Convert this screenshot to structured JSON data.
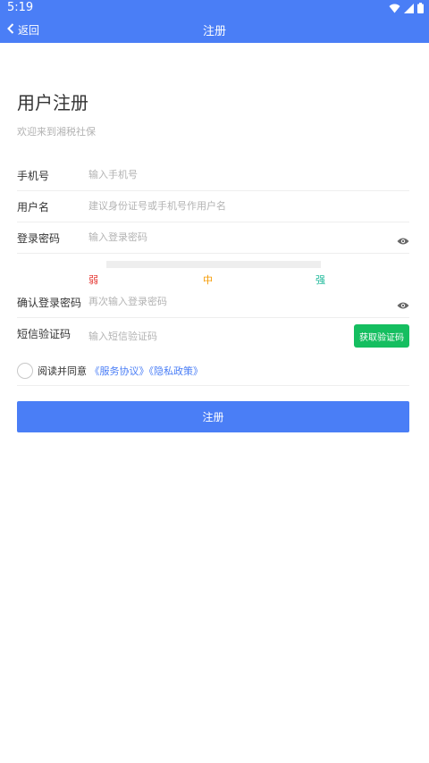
{
  "status_bar": {
    "time": "5:19"
  },
  "app_bar": {
    "back_label": "返回",
    "title": "注册"
  },
  "page": {
    "title": "用户注册",
    "subtitle": "欢迎来到湘税社保"
  },
  "fields": {
    "phone": {
      "label": "手机号",
      "placeholder": "输入手机号",
      "value": ""
    },
    "username": {
      "label": "用户名",
      "placeholder": "建议身份证号或手机号作用户名",
      "value": ""
    },
    "password": {
      "label": "登录密码",
      "placeholder": "输入登录密码",
      "value": ""
    },
    "confirm_password": {
      "label": "确认登录密码",
      "placeholder": "再次输入登录密码",
      "value": ""
    },
    "sms_code": {
      "label": "短信验证码",
      "placeholder": "输入短信验证码",
      "value": "",
      "button_label": "获取验证码"
    }
  },
  "strength": {
    "weak": "弱",
    "medium": "中",
    "strong": "强",
    "colors": {
      "weak": "#e53935",
      "medium": "#f59a00",
      "strong": "#1cb899"
    }
  },
  "agreement": {
    "prefix": "阅读并同意",
    "service": "《服务协议》",
    "privacy": "《隐私政策》",
    "checked": false
  },
  "submit": {
    "label": "注册"
  },
  "colors": {
    "primary": "#4a7ef6",
    "sms_button": "#15be60",
    "placeholder": "#b3b3b3"
  },
  "icons": [
    "wifi-icon",
    "signal-icon",
    "battery-icon",
    "back-chevron-icon",
    "eye-icon"
  ]
}
